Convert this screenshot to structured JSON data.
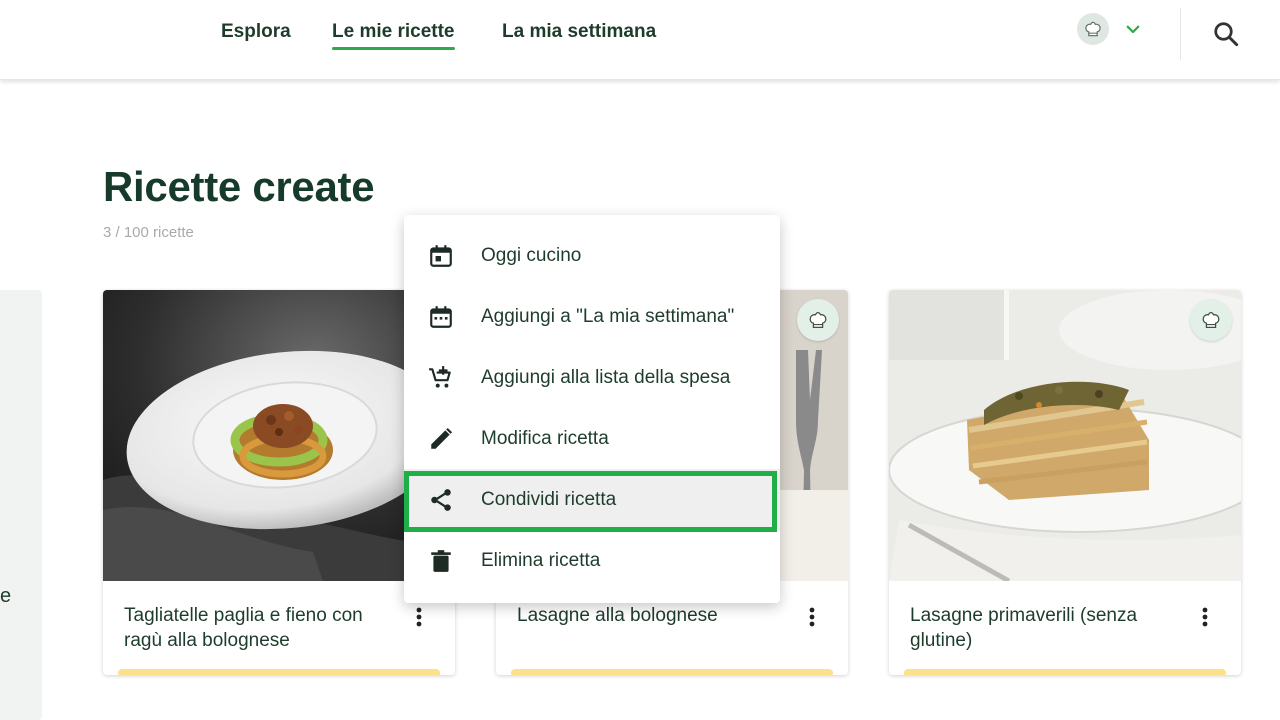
{
  "nav": {
    "explore": "Esplora",
    "my_recipes": "Le mie ricette",
    "my_week": "La mia settimana"
  },
  "icons": {
    "avatar": "chef-hat-icon",
    "dropdown": "chevron-down-icon",
    "search": "search-icon",
    "more": "more-vertical-icon",
    "badge": "chef-hat-icon"
  },
  "colors": {
    "brand_dark": "#173b2a",
    "accent_green": "#2eaa4a",
    "highlight_green": "#1fae47",
    "progress_yellow": "#fde08a"
  },
  "page": {
    "title": "Ricette create",
    "count": "3 / 100 ricette",
    "side_letter": "e"
  },
  "recipes": [
    {
      "title": "Tagliatelle paglia e fieno con ragù alla bolognese"
    },
    {
      "title": "Lasagne alla bolognese"
    },
    {
      "title": "Lasagne primaverili (senza glutine)"
    }
  ],
  "menu": {
    "items": [
      {
        "label": "Oggi cucino",
        "icon": "calendar-today-icon"
      },
      {
        "label": "Aggiungi a \"La mia settimana\"",
        "icon": "calendar-week-icon"
      },
      {
        "label": "Aggiungi alla lista della spesa",
        "icon": "cart-plus-icon"
      },
      {
        "label": "Modifica ricetta",
        "icon": "pencil-icon"
      },
      {
        "label": "Condividi ricetta",
        "icon": "share-icon",
        "highlighted": true
      },
      {
        "label": "Elimina ricetta",
        "icon": "trash-icon"
      }
    ]
  }
}
